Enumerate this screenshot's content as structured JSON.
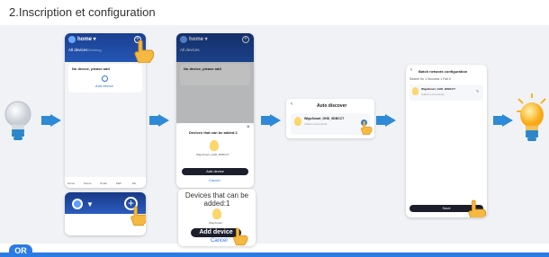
{
  "title": "2.Inscription et configuration",
  "screen1": {
    "home_label": "home ▾",
    "tab_all": "All devices",
    "tab_working": "Working",
    "no_device_text": "No device, please add",
    "add_device_link": "Add device",
    "nav": [
      "Home",
      "Scene",
      "Smart",
      "Mall",
      "Me"
    ]
  },
  "screen2": {
    "home_label": "home ▾",
    "tab_all": "All devices",
    "no_device_text": "No device, please add",
    "dialog_title": "Devices that can be added:1",
    "device_name": "WiguSmart_GHD_9DBCCT",
    "add_button": "Add device",
    "cancel": "Cancel"
  },
  "zoom1": {
    "text": ""
  },
  "zoom2": {
    "title": "Devices that can be added:1",
    "device_label": "WiguSmart",
    "add_button": "Add device",
    "cancel": "Cancel"
  },
  "screen3": {
    "header": "Auto discover",
    "device_name": "WiguSmart_GHD_9DBCCT",
    "device_sub": "Added successfully"
  },
  "screen4": {
    "header": "Batch network configuration",
    "status": "Search for 1  Success 1  Fail 0",
    "device_name": "WiguSmart_GHD_9DBCCT",
    "device_sub": "Added successfully",
    "save_button": "Save"
  },
  "or_label": "OR",
  "colors": {
    "accent": "#2a7be4",
    "header_blue": "#1f4fa8",
    "bulb_on": "#f9b11a",
    "bar": "#2a7be4"
  }
}
